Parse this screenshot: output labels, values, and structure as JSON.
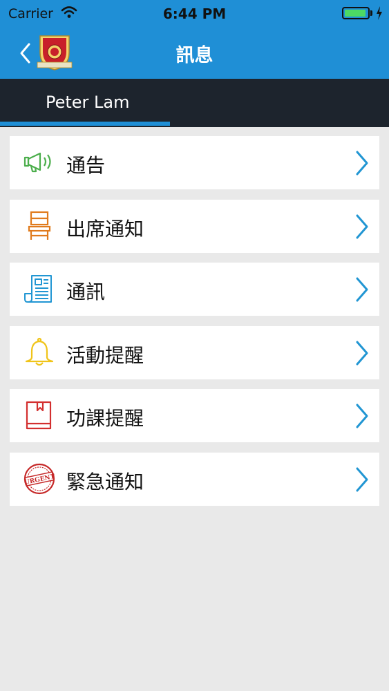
{
  "status_bar": {
    "carrier": "Carrier",
    "time": "6:44 PM",
    "battery_level": 0.95
  },
  "nav": {
    "title": "訊息",
    "back_icon": "chevron-left-icon",
    "logo": "school-crest-logo"
  },
  "tab": {
    "label": "Peter Lam"
  },
  "menu": {
    "items": [
      {
        "label": "通告",
        "icon": "megaphone-icon",
        "color": "#4cae4c"
      },
      {
        "label": "出席通知",
        "icon": "chair-icon",
        "color": "#e07a1c"
      },
      {
        "label": "通訊",
        "icon": "newspaper-icon",
        "color": "#2196d3"
      },
      {
        "label": "活動提醒",
        "icon": "bell-icon",
        "color": "#f0c419"
      },
      {
        "label": "功課提醒",
        "icon": "book-icon",
        "color": "#d32f2f"
      },
      {
        "label": "緊急通知",
        "icon": "urgent-stamp-icon",
        "color": "#c62828",
        "stamp_text": "URGENT"
      }
    ]
  },
  "colors": {
    "primary": "#1f8fd6",
    "tab_bg": "#1d242d",
    "chevron": "#2196d3"
  }
}
